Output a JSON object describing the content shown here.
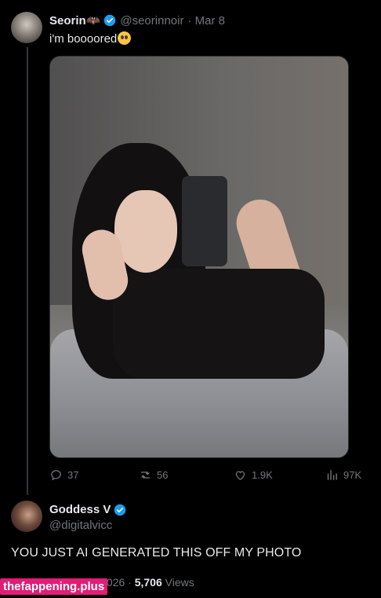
{
  "post": {
    "name": "Seorin🦇",
    "handle": "@seorinnoir",
    "date": "· Mar 8",
    "text": "i'm boooored"
  },
  "actions": {
    "replies": "37",
    "reposts": "56",
    "likes": "1.9K",
    "views": "97K"
  },
  "reply": {
    "name": "Goddess V",
    "handle": "@digitalvicc",
    "text": "YOU JUST AI GENERATED THIS OFF MY PHOTO",
    "time": "11:41 AM · Mar 9, 2026 ·",
    "view_count": "5,706",
    "views_label": "Views"
  },
  "watermark": "thefappening.plus",
  "colors": {
    "background": "#000000",
    "verified": "#1d9bf0",
    "muted": "#71767b",
    "watermark": "#e11d74"
  },
  "icons": [
    "verified-badge-icon",
    "reply-icon",
    "repost-icon",
    "like-icon",
    "views-icon"
  ]
}
